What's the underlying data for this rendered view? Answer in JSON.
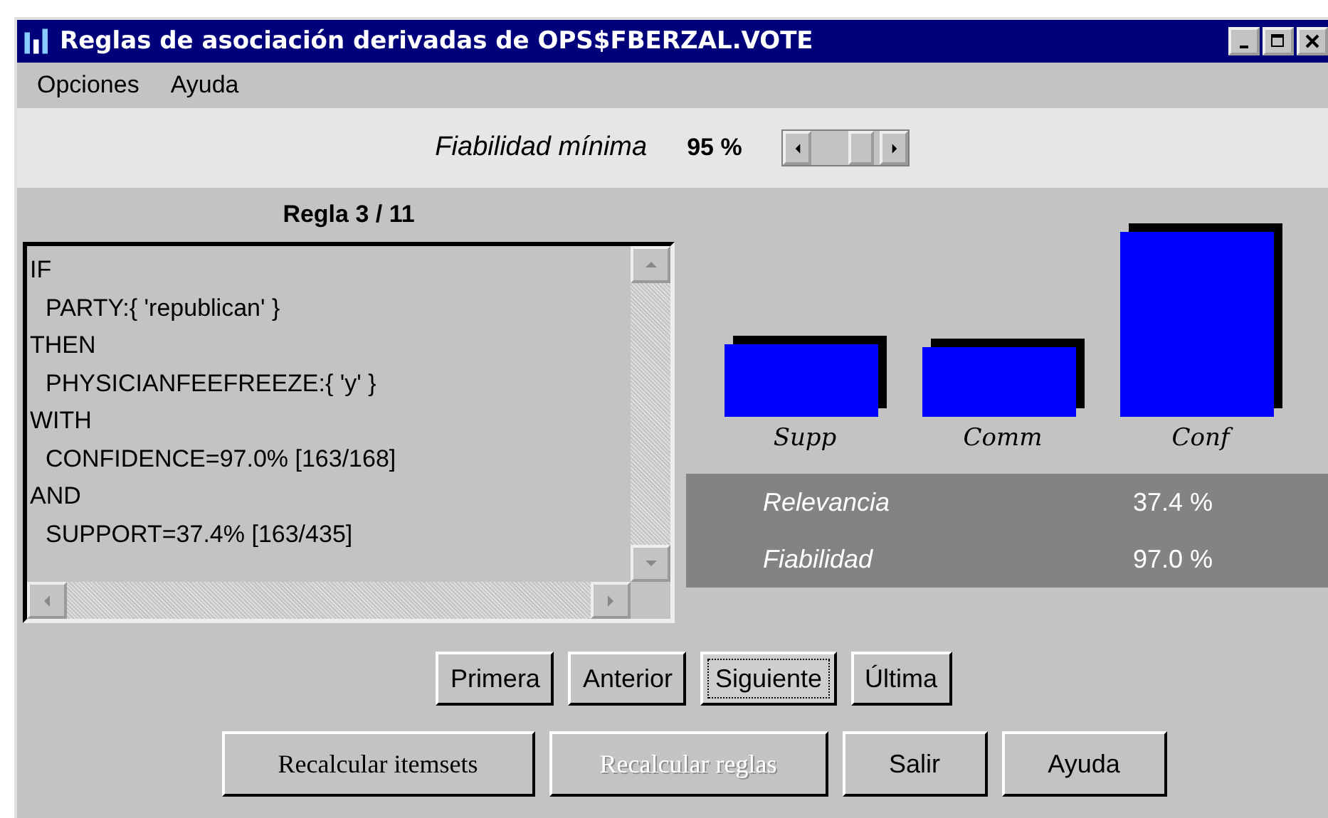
{
  "window": {
    "title": "Reglas de asociación derivadas de OPS$FBERZAL.VOTE"
  },
  "menu": [
    {
      "label": "Opciones"
    },
    {
      "label": "Ayuda"
    }
  ],
  "threshold": {
    "label": "Fiabilidad mínima",
    "value": "95 %"
  },
  "rule": {
    "heading": "Regla 3 / 11",
    "lines": [
      {
        "text": "IF",
        "indent": false
      },
      {
        "text": "PARTY:{ 'republican' }",
        "indent": true
      },
      {
        "text": "THEN",
        "indent": false
      },
      {
        "text": "PHYSICIANFEEFREEZE:{ 'y' }",
        "indent": true
      },
      {
        "text": "WITH",
        "indent": false
      },
      {
        "text": "CONFIDENCE=97.0% [163/168]",
        "indent": true
      },
      {
        "text": "AND",
        "indent": false
      },
      {
        "text": "SUPPORT=37.4% [163/435]",
        "indent": true
      }
    ]
  },
  "bars": [
    {
      "label": "Supp"
    },
    {
      "label": "Comm"
    },
    {
      "label": "Conf"
    }
  ],
  "stats": [
    {
      "label": "Relevancia",
      "value": "37.4 %"
    },
    {
      "label": "Fiabilidad",
      "value": "97.0 %"
    }
  ],
  "nav_buttons": [
    {
      "label": "Primera",
      "focused": false
    },
    {
      "label": "Anterior",
      "focused": false
    },
    {
      "label": "Siguiente",
      "focused": true
    },
    {
      "label": "Última",
      "focused": false
    }
  ],
  "action_buttons": [
    {
      "label": "Recalcular itemsets",
      "disabled": false
    },
    {
      "label": "Recalcular reglas",
      "disabled": true
    },
    {
      "label": "Salir",
      "disabled": false
    },
    {
      "label": "Ayuda",
      "disabled": false
    }
  ]
}
